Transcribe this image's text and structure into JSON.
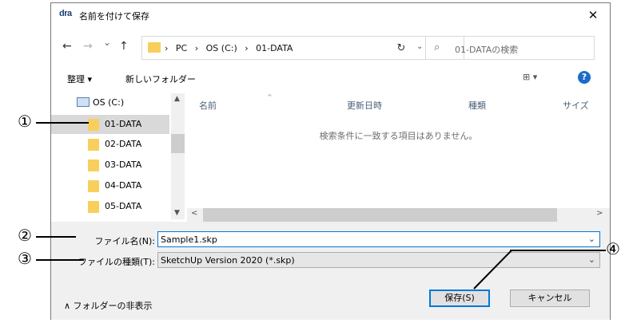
{
  "window": {
    "app_icon_text": "dra",
    "title": "名前を付けて保存",
    "close": "✕"
  },
  "nav": {
    "back": "←",
    "forward": "→",
    "recent": "⌄",
    "up": "↑",
    "breadcrumbs": [
      "›",
      "PC",
      "›",
      "OS (C:)",
      "›",
      "01-DATA"
    ],
    "address_dropdown": "⌄",
    "refresh": "↻",
    "search_icon": "⌕",
    "search_placeholder": "01-DATAの検索"
  },
  "toolbar": {
    "organize": "整理 ▾",
    "new_folder": "新しいフォルダー",
    "view": "⊞ ▾",
    "help": "?"
  },
  "tree": {
    "drive": "OS (C:)",
    "items": [
      "01-DATA",
      "02-DATA",
      "03-DATA",
      "04-DATA",
      "05-DATA"
    ],
    "selected_index": 0
  },
  "list": {
    "columns": [
      "名前",
      "更新日時",
      "種類",
      "サイズ"
    ],
    "empty_message": "検索条件に一致する項目はありません。"
  },
  "form": {
    "filename_label": "ファイル名(N):",
    "filename_value": "Sample1.skp",
    "filetype_label": "ファイルの種類(T):",
    "filetype_value": "SketchUp Version 2020 (*.skp)"
  },
  "footer": {
    "hide_folders": "∧ フォルダーの非表示",
    "save": "保存(S)",
    "cancel": "キャンセル"
  },
  "callouts": [
    "①",
    "②",
    "③",
    "④"
  ]
}
